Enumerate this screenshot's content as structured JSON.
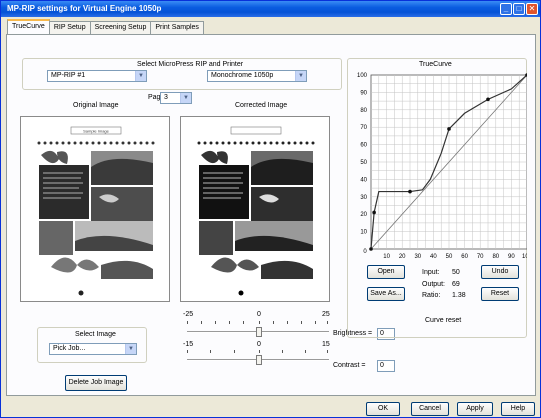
{
  "window": {
    "title": "MP-RIP settings for Virtual Engine 1050p"
  },
  "tabs": [
    "TrueCurve",
    "RIP Setup",
    "Screening Setup",
    "Print Samples"
  ],
  "rip_printer": {
    "heading": "Select MicroPress RIP and Printer",
    "rip_value": "MP-RIP #1",
    "printer_value": "Monochrome 1050p"
  },
  "preview": {
    "original_label": "Original Image",
    "corrected_label": "Corrected Image",
    "page_label": "Page:",
    "page_value": "3",
    "doc_heading": "Sample Image"
  },
  "select_image": {
    "heading": "Select Image",
    "value": "Pick Job...",
    "delete_label": "Delete Job Image"
  },
  "sliders": {
    "brightness": {
      "min_label": "-25",
      "mid_label": "0",
      "max_label": "25",
      "label": "Brightness =",
      "value": "0"
    },
    "contrast": {
      "min_label": "-15",
      "mid_label": "0",
      "max_label": "15",
      "label": "Contrast =",
      "value": "0"
    }
  },
  "truecurve": {
    "heading": "TrueCurve",
    "open_label": "Open",
    "save_as_label": "Save As...",
    "undo_label": "Undo",
    "reset_label": "Reset",
    "curve_reset_label": "Curve reset",
    "input_label": "Input:",
    "input_value": "50",
    "output_label": "Output:",
    "output_value": "69",
    "ratio_label": "Ratio:",
    "ratio_value": "1.38"
  },
  "footer": {
    "ok_label": "OK",
    "cancel_label": "Cancel",
    "apply_label": "Apply",
    "help_label": "Help"
  },
  "chart_data": {
    "type": "line",
    "title": "TrueCurve",
    "xlim": [
      0,
      100
    ],
    "ylim": [
      0,
      100
    ],
    "xticks": [
      10,
      20,
      30,
      40,
      50,
      60,
      70,
      80,
      90,
      100
    ],
    "yticks": [
      10,
      20,
      30,
      40,
      50,
      60,
      70,
      80,
      90,
      100
    ],
    "grid": true,
    "series": [
      {
        "values_x": [
          0,
          100
        ],
        "values_y": [
          0,
          100
        ]
      },
      {
        "values_x": [
          0,
          2,
          5,
          25,
          33,
          38,
          45,
          50,
          60,
          75,
          90,
          100
        ],
        "values_y": [
          0,
          21,
          33,
          33,
          34,
          40,
          55,
          69,
          78,
          86,
          92,
          100
        ]
      }
    ],
    "control_points": [
      {
        "x": 0,
        "y": 0
      },
      {
        "x": 2,
        "y": 21
      },
      {
        "x": 25,
        "y": 33
      },
      {
        "x": 50,
        "y": 69
      },
      {
        "x": 75,
        "y": 86
      },
      {
        "x": 100,
        "y": 100
      }
    ]
  }
}
